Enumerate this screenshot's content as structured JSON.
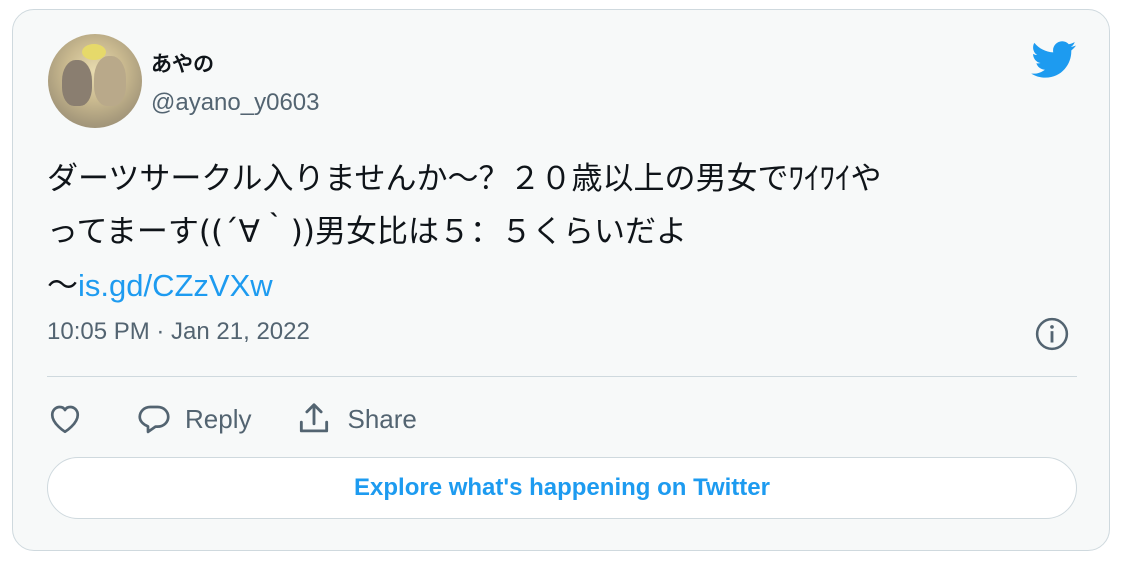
{
  "author": {
    "display_name": "あやの",
    "handle": "@ayano_y0603"
  },
  "tweet": {
    "line1": "ダーツサークル入りませんか〜？２０歳以上の男女でﾜｲﾜｲや",
    "line2": "ってまーす((´∀｀))男女比は５：５くらいだよ",
    "line3_prefix": "〜",
    "link_text": "is.gd/CZzVXw"
  },
  "meta": {
    "timestamp": "10:05 PM · Jan 21, 2022"
  },
  "actions": {
    "reply_label": "Reply",
    "share_label": "Share"
  },
  "explore_button": {
    "label": "Explore what's happening on Twitter"
  },
  "colors": {
    "accent": "#1d9bf0",
    "text": "#0f1419",
    "muted": "#536471",
    "border": "#cfd9de",
    "card_bg": "#f7f9f9"
  },
  "icons": [
    "twitter-bird-icon",
    "info-icon",
    "heart-icon",
    "reply-icon",
    "share-icon"
  ]
}
